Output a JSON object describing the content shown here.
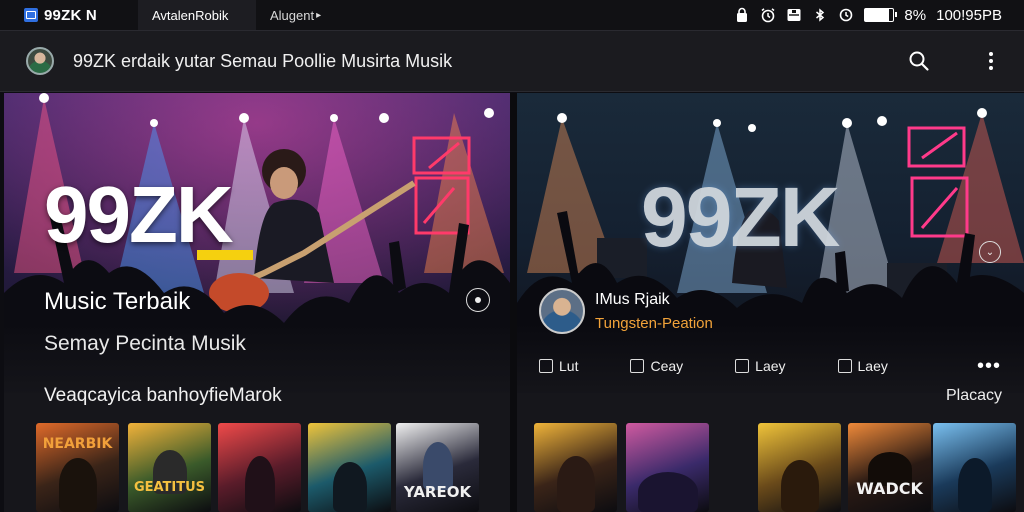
{
  "statusbar": {
    "app_title": "99ZK N",
    "tabs": [
      {
        "label": "AvtalenRobik",
        "active": true
      },
      {
        "label": "Alugent",
        "active": false
      }
    ],
    "battery_text": "8%",
    "battery_level": 0.85,
    "time_text": "100!95PB"
  },
  "appbar": {
    "title": "99ZK erdaik yutar Semau Poollie Musirta Musik"
  },
  "left_panel": {
    "logo": "99ZK",
    "hero_title": "Music Terbaik",
    "hero_subtitle": "Semay Pecinta Musik",
    "section_title": "Veaqcayica banhoyfieMarok",
    "tiles": [
      {
        "label": "NEARBIK",
        "bg": "#3a2418",
        "accent": "#e06a2a"
      },
      {
        "label": "GEATITUS",
        "bg": "#3a5a2a",
        "accent": "#f2b23a"
      },
      {
        "label": "",
        "bg": "#5a1c2a",
        "accent": "#f04a4a"
      },
      {
        "label": "",
        "bg": "#1c5a6a",
        "accent": "#f0c43a"
      },
      {
        "label": "YAREOK",
        "bg": "#2a2a3a",
        "accent": "#f0f0f0"
      }
    ]
  },
  "right_panel": {
    "logo": "99ZK",
    "artist_name": "IMus Rjaik",
    "artist_role": "Tungsten-Peation",
    "actions": [
      "Lut",
      "Ceay",
      "Laey",
      "Laey"
    ],
    "section_action": "Placacy",
    "tiles": [
      {
        "label": "",
        "bg": "#3a2418",
        "accent": "#f0b43a"
      },
      {
        "label": "",
        "bg": "#3a2a6a",
        "accent": "#d05aa0"
      },
      {
        "label": "",
        "bg": "#6a4a1a",
        "accent": "#f0c43a"
      },
      {
        "label": "WADCK",
        "bg": "#2a1a14",
        "accent": "#f08a3a"
      },
      {
        "label": "",
        "bg": "#1a3a5a",
        "accent": "#7ac0f0"
      }
    ]
  },
  "icons": {
    "status": [
      "lock-icon",
      "alarm-icon",
      "mail-icon",
      "bluetooth-icon",
      "sync-icon",
      "battery-icon"
    ],
    "appbar": [
      "search-icon",
      "more-vert-icon"
    ]
  },
  "colors": {
    "accent_yellow": "#f5d00f",
    "artist_role": "#f2a33a",
    "background": "#0d0d12"
  }
}
